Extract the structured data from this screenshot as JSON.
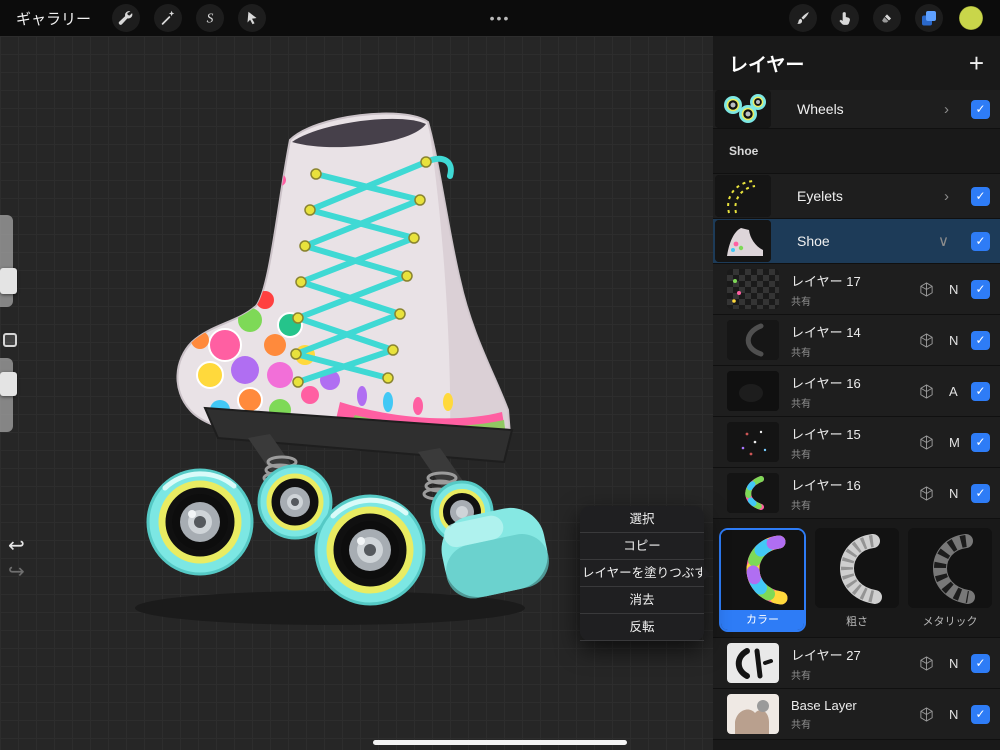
{
  "top_bar": {
    "gallery_label": "ギャラリー"
  },
  "icons": {
    "more": "•••",
    "add": "+",
    "check": "✓",
    "chevron_right": "›",
    "chevron_down": "∨",
    "undo": "↩",
    "redo": "↪"
  },
  "context_menu": {
    "items": [
      "選択",
      "コピー",
      "レイヤーを塗りつぶす",
      "消去",
      "反転"
    ]
  },
  "layers_panel": {
    "title": "レイヤー",
    "wheels_row": {
      "label": "Wheels"
    },
    "section_label": "Shoe",
    "eyelets_row": {
      "label": "Eyelets"
    },
    "shoe_row": {
      "label": "Shoe"
    },
    "sub_layers": [
      {
        "label": "レイヤー 17",
        "shared": "共有",
        "blend": "N"
      },
      {
        "label": "レイヤー 14",
        "shared": "共有",
        "blend": "N"
      },
      {
        "label": "レイヤー 16",
        "shared": "共有",
        "blend": "A"
      },
      {
        "label": "レイヤー 15",
        "shared": "共有",
        "blend": "M"
      },
      {
        "label": "レイヤー 16",
        "shared": "共有",
        "blend": "N"
      }
    ],
    "material_cards": [
      {
        "label": "カラー",
        "selected": true
      },
      {
        "label": "粗さ",
        "selected": false
      },
      {
        "label": "メタリック",
        "selected": false
      }
    ],
    "bottom_layers": [
      {
        "label": "レイヤー 27",
        "shared": "共有",
        "blend": "N"
      },
      {
        "label": "Base Layer",
        "shared": "共有",
        "blend": "N"
      }
    ]
  },
  "colors": {
    "accent_blue": "#2e7cf6",
    "selected_row_bg": "#1d3b58",
    "color_swatch": "#c9d64a",
    "lace_cyan": "#3fd9d4",
    "wheel_cyan": "#7ce7e3",
    "wheel_yellow": "#e9ec62"
  }
}
